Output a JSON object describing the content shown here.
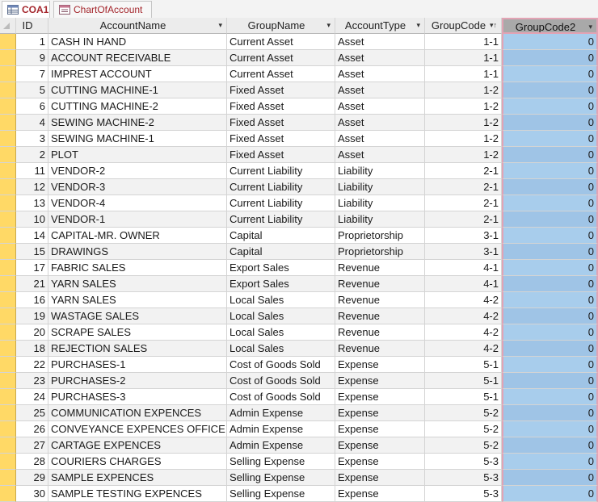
{
  "tabs": [
    {
      "label": "COA1",
      "icon": "table-icon"
    },
    {
      "label": "ChartOfAccount",
      "icon": "form-icon"
    }
  ],
  "columns": [
    "ID",
    "AccountName",
    "GroupName",
    "AccountType",
    "GroupCode",
    "GroupCode2"
  ],
  "rows": [
    [
      "1",
      "CASH IN HAND",
      "Current Asset",
      "Asset",
      "1-1",
      "0"
    ],
    [
      "9",
      "ACCOUNT RECEIVABLE",
      "Current Asset",
      "Asset",
      "1-1",
      "0"
    ],
    [
      "7",
      "IMPREST ACCOUNT",
      "Current Asset",
      "Asset",
      "1-1",
      "0"
    ],
    [
      "5",
      "CUTTING MACHINE-1",
      "Fixed Asset",
      "Asset",
      "1-2",
      "0"
    ],
    [
      "6",
      "CUTTING MACHINE-2",
      "Fixed Asset",
      "Asset",
      "1-2",
      "0"
    ],
    [
      "4",
      "SEWING MACHINE-2",
      "Fixed Asset",
      "Asset",
      "1-2",
      "0"
    ],
    [
      "3",
      "SEWING MACHINE-1",
      "Fixed Asset",
      "Asset",
      "1-2",
      "0"
    ],
    [
      "2",
      "PLOT",
      "Fixed Asset",
      "Asset",
      "1-2",
      "0"
    ],
    [
      "11",
      "VENDOR-2",
      "Current Liability",
      "Liability",
      "2-1",
      "0"
    ],
    [
      "12",
      "VENDOR-3",
      "Current Liability",
      "Liability",
      "2-1",
      "0"
    ],
    [
      "13",
      "VENDOR-4",
      "Current Liability",
      "Liability",
      "2-1",
      "0"
    ],
    [
      "10",
      "VENDOR-1",
      "Current Liability",
      "Liability",
      "2-1",
      "0"
    ],
    [
      "14",
      "CAPITAL-MR. OWNER",
      "Capital",
      "Proprietorship",
      "3-1",
      "0"
    ],
    [
      "15",
      "DRAWINGS",
      "Capital",
      "Proprietorship",
      "3-1",
      "0"
    ],
    [
      "17",
      "FABRIC SALES",
      "Export Sales",
      "Revenue",
      "4-1",
      "0"
    ],
    [
      "21",
      "YARN SALES",
      "Export Sales",
      "Revenue",
      "4-1",
      "0"
    ],
    [
      "16",
      "YARN SALES",
      "Local Sales",
      "Revenue",
      "4-2",
      "0"
    ],
    [
      "19",
      "WASTAGE  SALES",
      "Local Sales",
      "Revenue",
      "4-2",
      "0"
    ],
    [
      "20",
      "SCRAPE SALES",
      "Local Sales",
      "Revenue",
      "4-2",
      "0"
    ],
    [
      "18",
      "REJECTION SALES",
      "Local Sales",
      "Revenue",
      "4-2",
      "0"
    ],
    [
      "22",
      "PURCHASES-1",
      "Cost of Goods Sold",
      "Expense",
      "5-1",
      "0"
    ],
    [
      "23",
      "PURCHASES-2",
      "Cost of Goods Sold",
      "Expense",
      "5-1",
      "0"
    ],
    [
      "24",
      "PURCHASES-3",
      "Cost of Goods Sold",
      "Expense",
      "5-1",
      "0"
    ],
    [
      "25",
      "COMMUNICATION EXPENCES",
      "Admin Expense",
      "Expense",
      "5-2",
      "0"
    ],
    [
      "26",
      "CONVEYANCE EXPENCES OFFICE",
      "Admin Expense",
      "Expense",
      "5-2",
      "0"
    ],
    [
      "27",
      "CARTAGE  EXPENCES",
      "Admin Expense",
      "Expense",
      "5-2",
      "0"
    ],
    [
      "28",
      "COURIERS CHARGES",
      "Selling Expense",
      "Expense",
      "5-3",
      "0"
    ],
    [
      "29",
      "SAMPLE EXPENCES",
      "Selling Expense",
      "Expense",
      "5-3",
      "0"
    ],
    [
      "30",
      "SAMPLE TESTING EXPENCES",
      "Selling Expense",
      "Expense",
      "5-3",
      "0"
    ]
  ],
  "sort_indicators": {
    "AccountName": "dropdown-arrow",
    "GroupName": "dropdown-arrow",
    "AccountType": "dropdown-arrow",
    "GroupCode": "sort-asc-arrow",
    "GroupCode2": "dropdown-arrow"
  },
  "colors": {
    "selector": "#ffd966",
    "selected_column": "#a8cdec",
    "selected_outline": "#e2a3b4",
    "tab_text": "#a4262c"
  }
}
